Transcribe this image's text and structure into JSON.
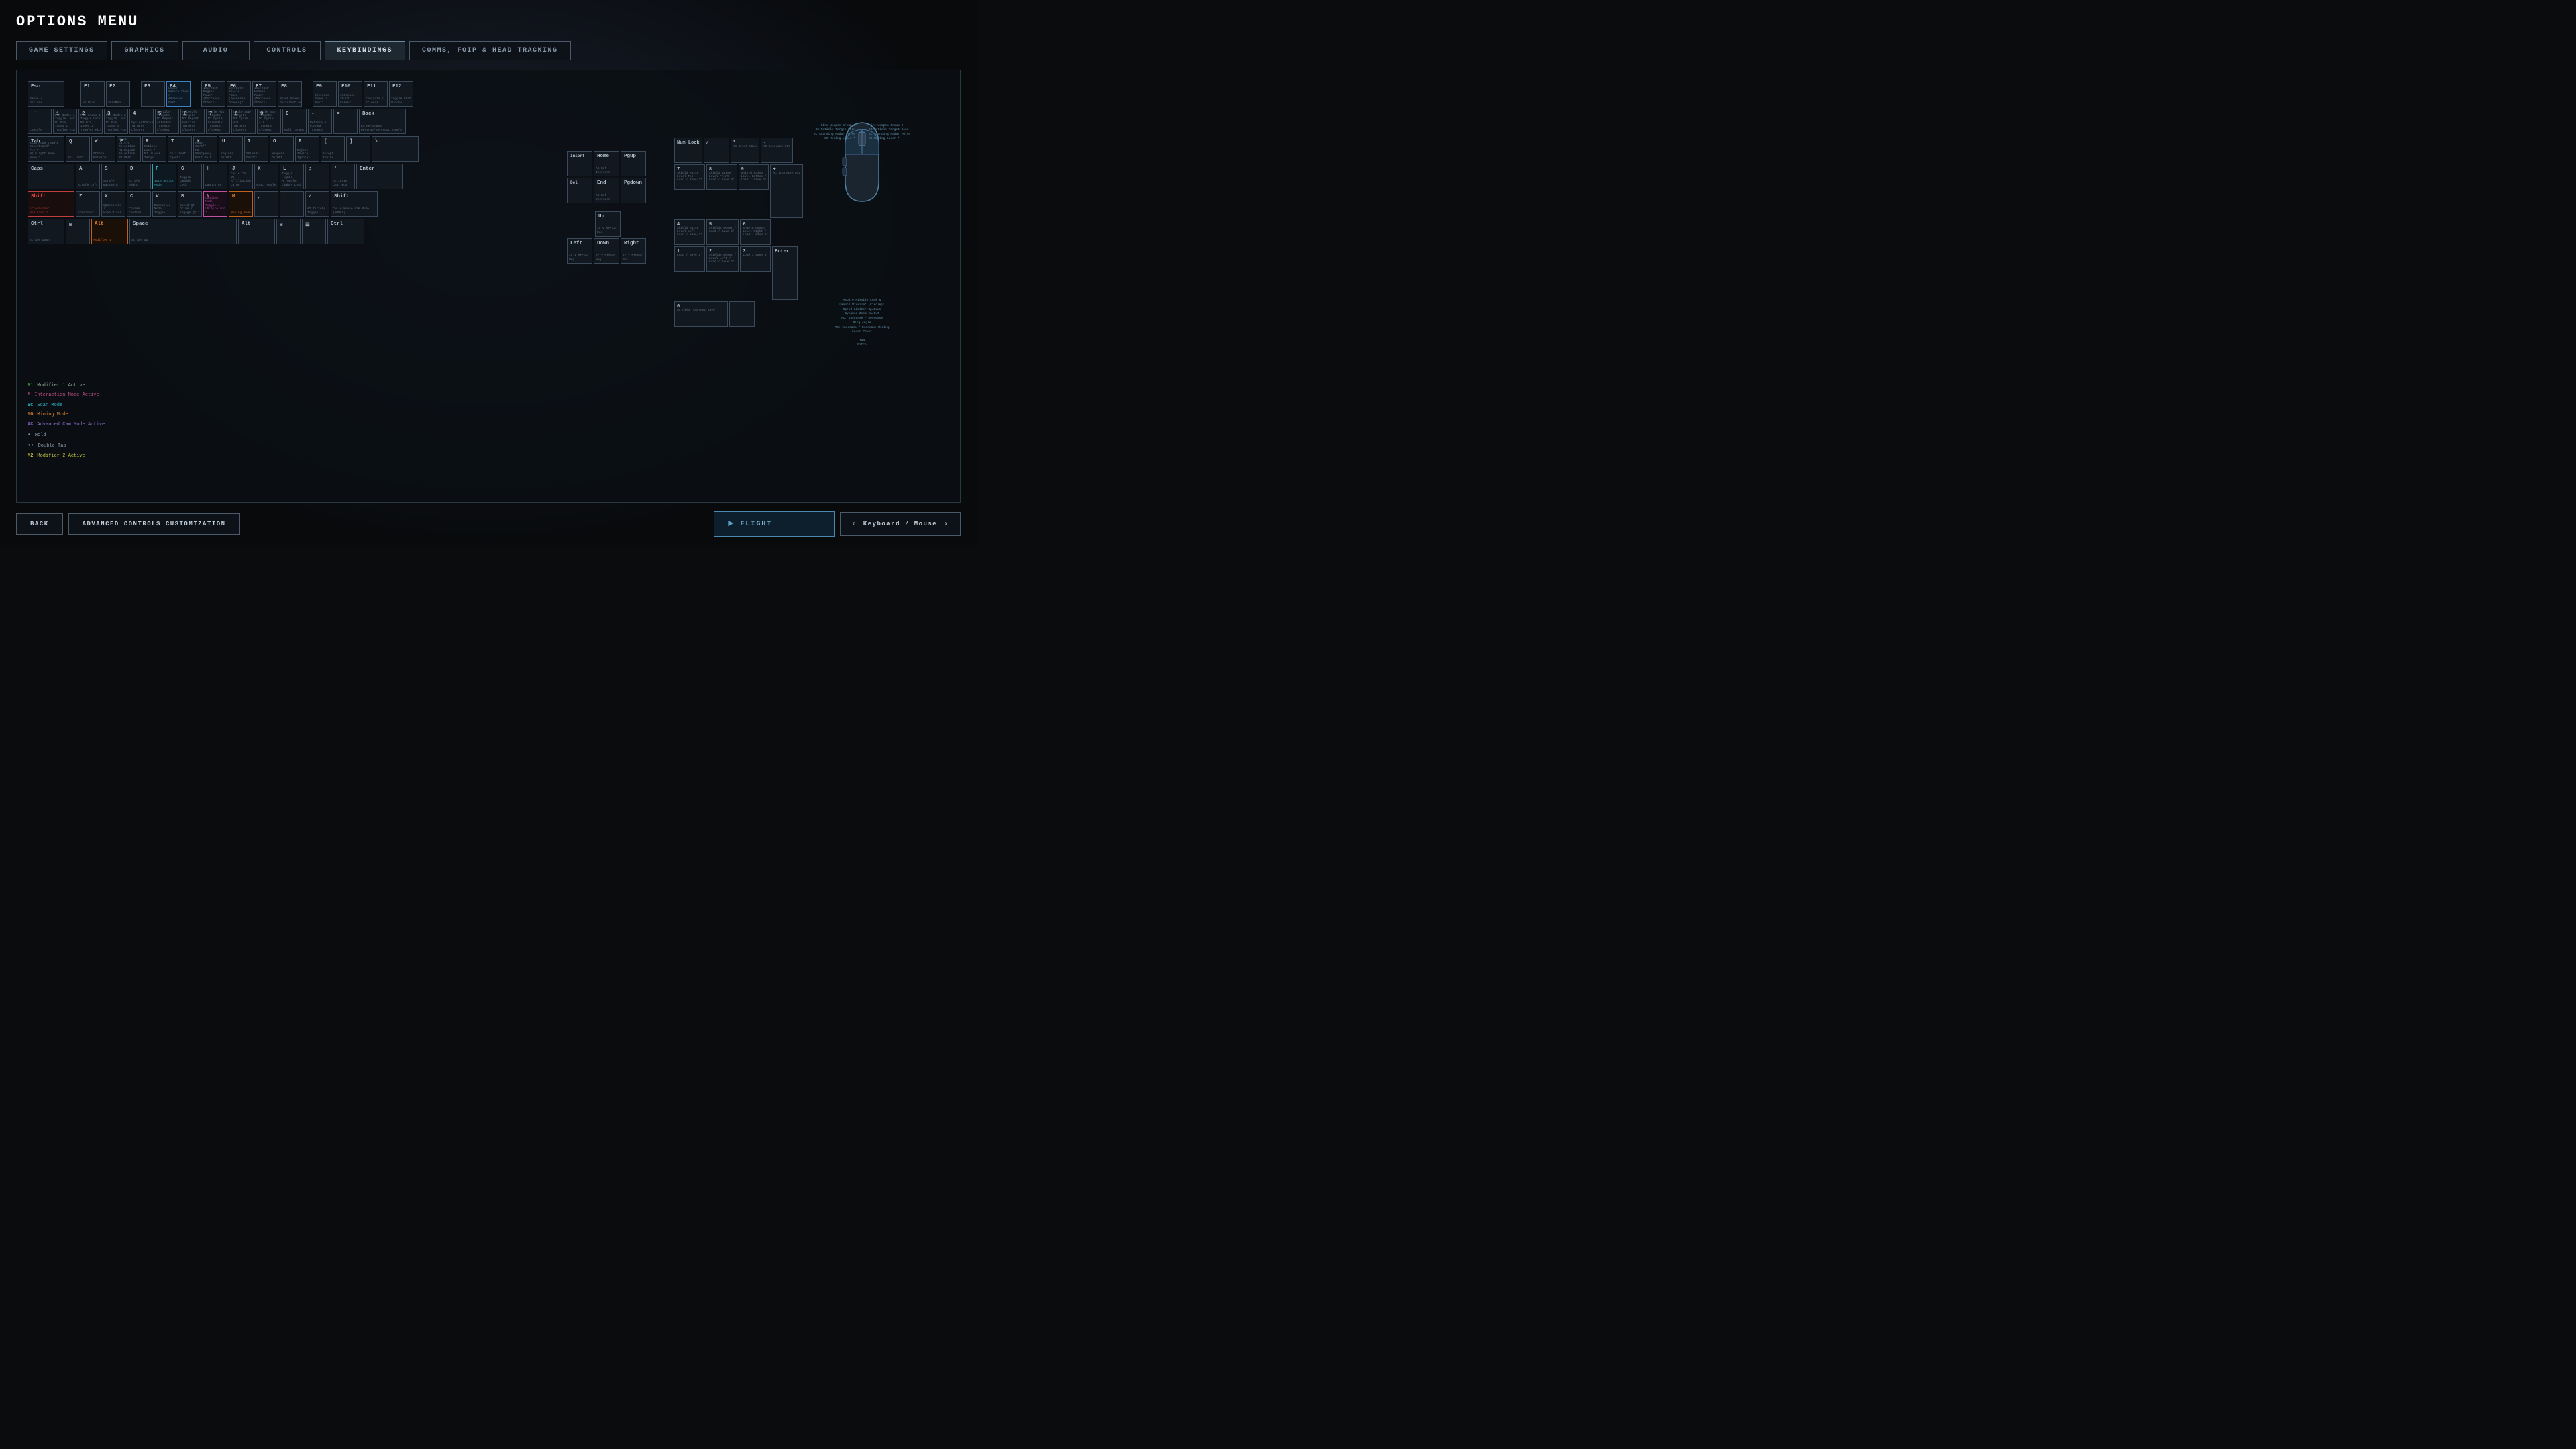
{
  "title": "OPTIONS MENU",
  "nav": {
    "tabs": [
      {
        "id": "game-settings",
        "label": "GAME SETTINGS",
        "active": false
      },
      {
        "id": "graphics",
        "label": "GRAPHICS",
        "active": false
      },
      {
        "id": "audio",
        "label": "AUDIO",
        "active": false
      },
      {
        "id": "controls",
        "label": "CONTROLS",
        "active": false
      },
      {
        "id": "keybindings",
        "label": "KEYBINDINGS",
        "active": true
      },
      {
        "id": "comms",
        "label": "COMMS, FOIP & HEAD TRACKING",
        "active": false
      }
    ]
  },
  "legend": {
    "items": [
      {
        "key": "M1",
        "class": "m1",
        "label": "Modifier 1 Active"
      },
      {
        "key": "M",
        "class": "m",
        "label": "Interaction Mode Active"
      },
      {
        "key": "SC",
        "class": "sc",
        "label": "Scan Mode"
      },
      {
        "key": "MG",
        "class": "mg",
        "label": "Mining Mode"
      },
      {
        "key": "AC",
        "class": "ac",
        "label": "Advanced Cam Mode Active"
      },
      {
        "dot": "•",
        "label": "Hold"
      },
      {
        "dot": "••",
        "label": "Double Tap"
      },
      {
        "key": "M2",
        "class": "m2",
        "label": "Modifier 2 Active"
      }
    ]
  },
  "bottom": {
    "back_label": "BACK",
    "advanced_label": "ADVANCED CONTROLS CUSTOMIZATION",
    "flight_label": "FLIGHT",
    "keyboard_mouse_label": "Keyboard / Mouse"
  }
}
